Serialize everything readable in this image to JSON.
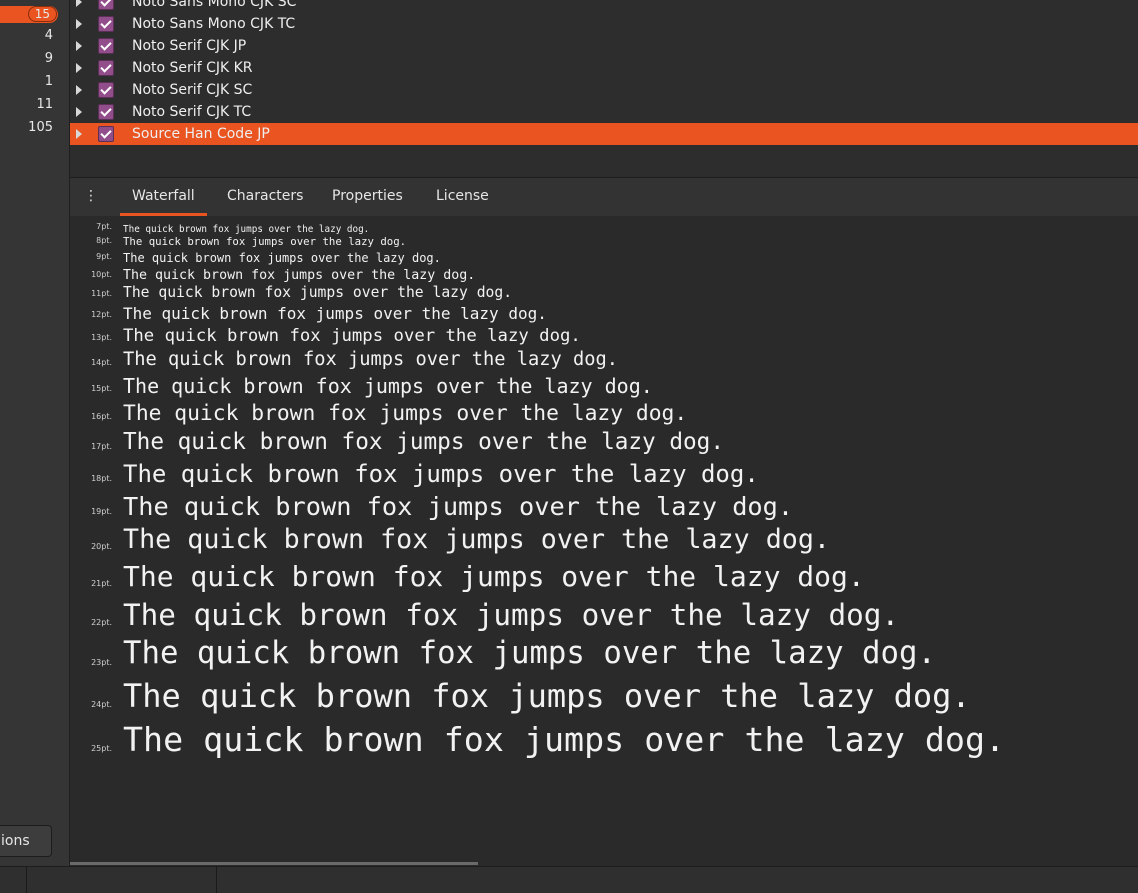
{
  "sidebar": {
    "counts": [
      {
        "value": "15",
        "selected": true
      },
      {
        "value": "4"
      },
      {
        "value": "9"
      },
      {
        "value": "1"
      },
      {
        "value": "11"
      },
      {
        "value": "105"
      }
    ],
    "options_label": "ions"
  },
  "font_list": [
    {
      "name": "Noto Sans Mono CJK SC"
    },
    {
      "name": "Noto Sans Mono CJK TC"
    },
    {
      "name": "Noto Serif CJK JP"
    },
    {
      "name": "Noto Serif CJK KR"
    },
    {
      "name": "Noto Serif CJK SC"
    },
    {
      "name": "Noto Serif CJK TC"
    },
    {
      "name": "Source Han Code JP",
      "selected": true
    }
  ],
  "tabs": [
    {
      "label": "Waterfall",
      "active": true
    },
    {
      "label": "Characters"
    },
    {
      "label": "Properties"
    },
    {
      "label": "License"
    }
  ],
  "waterfall": {
    "sample": "The quick brown fox jumps over the lazy dog.",
    "rows": [
      {
        "label": "7pt.",
        "size": 7
      },
      {
        "label": "8pt.",
        "size": 8
      },
      {
        "label": "9pt.",
        "size": 9
      },
      {
        "label": "10pt.",
        "size": 10
      },
      {
        "label": "11pt.",
        "size": 11
      },
      {
        "label": "12pt.",
        "size": 12
      },
      {
        "label": "13pt.",
        "size": 13
      },
      {
        "label": "14pt.",
        "size": 14
      },
      {
        "label": "15pt.",
        "size": 15
      },
      {
        "label": "16pt.",
        "size": 16
      },
      {
        "label": "17pt.",
        "size": 17
      },
      {
        "label": "18pt.",
        "size": 18
      },
      {
        "label": "19pt.",
        "size": 19
      },
      {
        "label": "20pt.",
        "size": 20
      },
      {
        "label": "21pt.",
        "size": 21
      },
      {
        "label": "22pt.",
        "size": 22
      },
      {
        "label": "23pt.",
        "size": 23
      },
      {
        "label": "24pt.",
        "size": 24
      },
      {
        "label": "25pt.",
        "size": 25
      }
    ]
  },
  "colors": {
    "accent": "#e95420",
    "checkbox": "#924d8b"
  }
}
